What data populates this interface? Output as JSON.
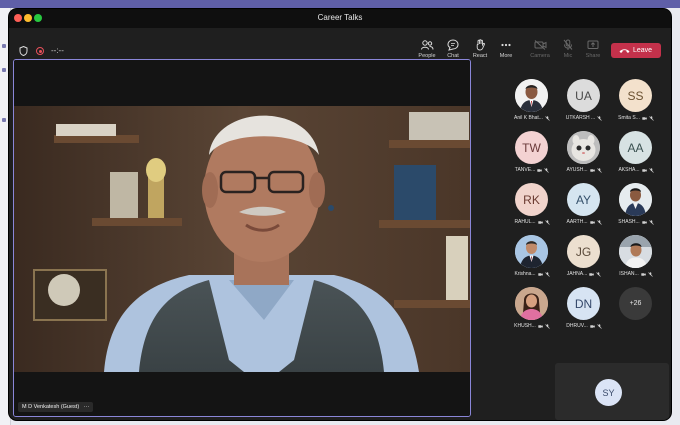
{
  "window": {
    "title": "Career Talks"
  },
  "toolbar": {
    "timer": "--:--",
    "buttons": [
      {
        "label": "People",
        "icon": "people-icon"
      },
      {
        "label": "Chat",
        "icon": "chat-icon"
      },
      {
        "label": "React",
        "icon": "react-hand-icon"
      },
      {
        "label": "More",
        "icon": "more-icon"
      },
      {
        "label": "Camera",
        "icon": "camera-off-icon"
      },
      {
        "label": "Mic",
        "icon": "mic-off-icon"
      },
      {
        "label": "Share",
        "icon": "share-icon"
      }
    ],
    "leave_label": "Leave"
  },
  "stage": {
    "speaker_name": "M D Venkatesh (Guest)",
    "more_glyph": "···"
  },
  "participants": [
    {
      "name": "Anil K Bhat...",
      "initials": "",
      "avatar": "photo",
      "bg": "#d9d9d9"
    },
    {
      "name": "UTKARSH ...",
      "initials": "UA",
      "avatar": "initials",
      "bg": "#dcdcdc"
    },
    {
      "name": "Smita S...",
      "initials": "SS",
      "avatar": "initials",
      "bg": "#f3e1cc"
    },
    {
      "name": "TANVE...",
      "initials": "TW",
      "avatar": "initials",
      "bg": "#f3d2d2"
    },
    {
      "name": "AYUSH...",
      "initials": "",
      "avatar": "photo",
      "bg": "#cfcfcf"
    },
    {
      "name": "AKSHA...",
      "initials": "AA",
      "avatar": "initials",
      "bg": "#d7e2e3"
    },
    {
      "name": "RAHUL...",
      "initials": "RK",
      "avatar": "initials",
      "bg": "#f1d4cc"
    },
    {
      "name": "AARTH...",
      "initials": "AY",
      "avatar": "initials",
      "bg": "#d5e5f0"
    },
    {
      "name": "SHASH...",
      "initials": "",
      "avatar": "photo",
      "bg": "#c9c9c9"
    },
    {
      "name": "Krishna...",
      "initials": "",
      "avatar": "photo",
      "bg": "#bcd0e6"
    },
    {
      "name": "JAHNA...",
      "initials": "JG",
      "avatar": "initials",
      "bg": "#ecdfcf"
    },
    {
      "name": "ISHAN...",
      "initials": "",
      "avatar": "photo",
      "bg": "#dfe3e6"
    },
    {
      "name": "KHUSH...",
      "initials": "",
      "avatar": "photo",
      "bg": "#d8b9a2"
    },
    {
      "name": "DHRUV...",
      "initials": "DN",
      "avatar": "initials",
      "bg": "#d7e4f3"
    }
  ],
  "overflow": {
    "label": "+26"
  },
  "self_view": {
    "initials": "SY"
  }
}
